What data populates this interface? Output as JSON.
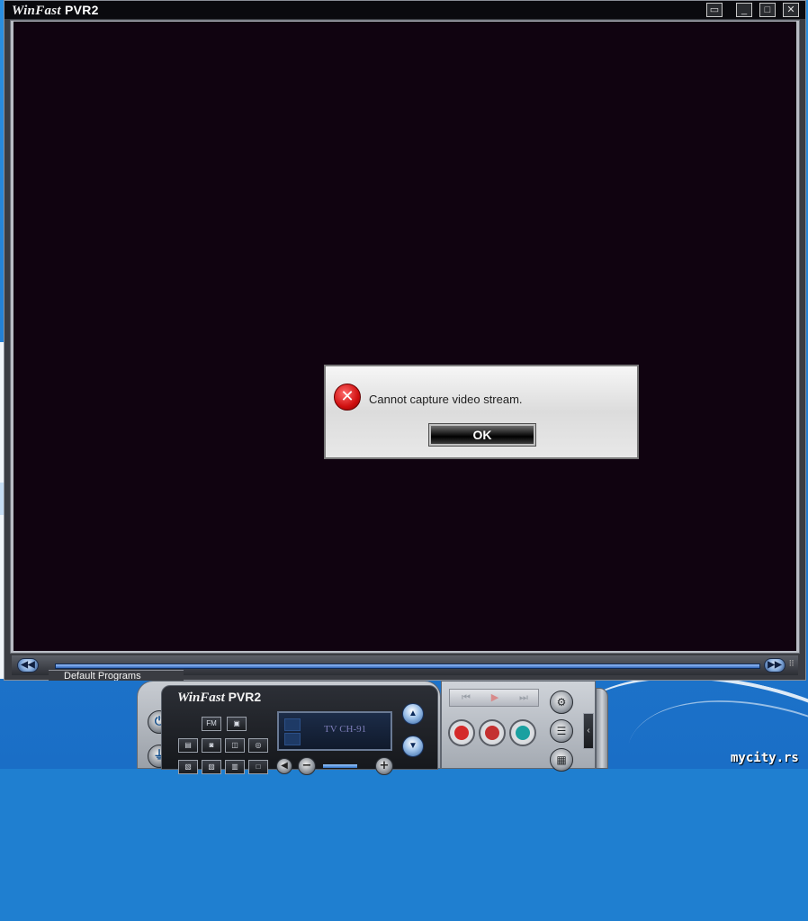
{
  "window": {
    "title_brand": "WinFast",
    "title_product": "PVR2",
    "buttons": {
      "restore_small": "▭",
      "minimize": "_",
      "maximize": "□",
      "close": "✕"
    }
  },
  "seekbar": {
    "rewind": "◀◀",
    "forward": "▶▶"
  },
  "background_window": {
    "tab_label": "Default Programs"
  },
  "dialog": {
    "icon": "error-x-icon",
    "error_glyph": "✕",
    "message": "Cannot capture video stream.",
    "ok_label": "OK"
  },
  "control_panel": {
    "brand": "WinFast",
    "product": "PVR2",
    "power_glyph": "⏻",
    "source_glyph": "⏚",
    "fm_label": "FM",
    "lcd_text": "TV CH-91",
    "up_glyph": "▲",
    "down_glyph": "▼",
    "vol_minus": "−",
    "vol_plus": "+",
    "transport": {
      "prev": "⏮",
      "play": "▶",
      "next": "⏭"
    },
    "side": {
      "tools": "⚙",
      "list": "☰",
      "keypad": "▦"
    },
    "collapse_glyph": "‹",
    "accent_colors": {
      "record": "#d42a2a",
      "timeshift": "#c43030",
      "teal": "#1aa0a0"
    }
  },
  "watermark": "mycity.rs"
}
